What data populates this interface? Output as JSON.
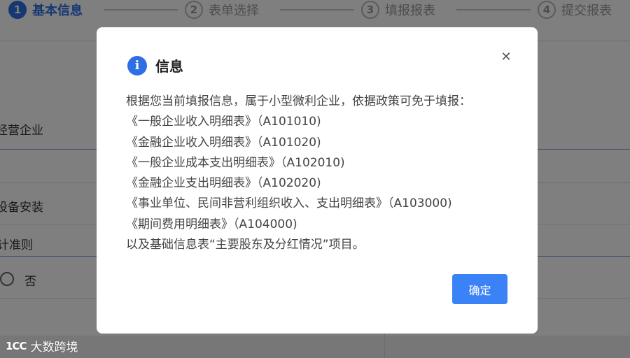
{
  "steps": [
    {
      "num": "1",
      "label": "基本信息"
    },
    {
      "num": "2",
      "label": "表单选择"
    },
    {
      "num": "3",
      "label": "填报报表"
    },
    {
      "num": "4",
      "label": "提交报表"
    }
  ],
  "background_form": {
    "field_1": "经营企业",
    "field_2": "设备安装",
    "field_3": "计准则",
    "radio_no": "否"
  },
  "watermark": {
    "logo": "1CC",
    "text": "大数跨境"
  },
  "dialog": {
    "title": "信息",
    "close_symbol": "✕",
    "lines": [
      "根据您当前填报信息，属于小型微利企业，依据政策可免于填报：",
      "《一般企业收入明细表》（A101010)",
      "《金融企业收入明细表》（A101020)",
      "《一般企业成本支出明细表》（A102010)",
      "《金融企业支出明细表》（A102020)",
      "《事业单位、民间非营利组织收入、支出明细表》（A103000)",
      "《期间费用明细表》（A104000)",
      "以及基础信息表“主要股东及分红情况”项目。"
    ],
    "confirm_label": "确定"
  },
  "colors": {
    "primary": "#2f6fe6",
    "button": "#3b82f6",
    "mask": "rgba(0,0,0,0.5)"
  }
}
